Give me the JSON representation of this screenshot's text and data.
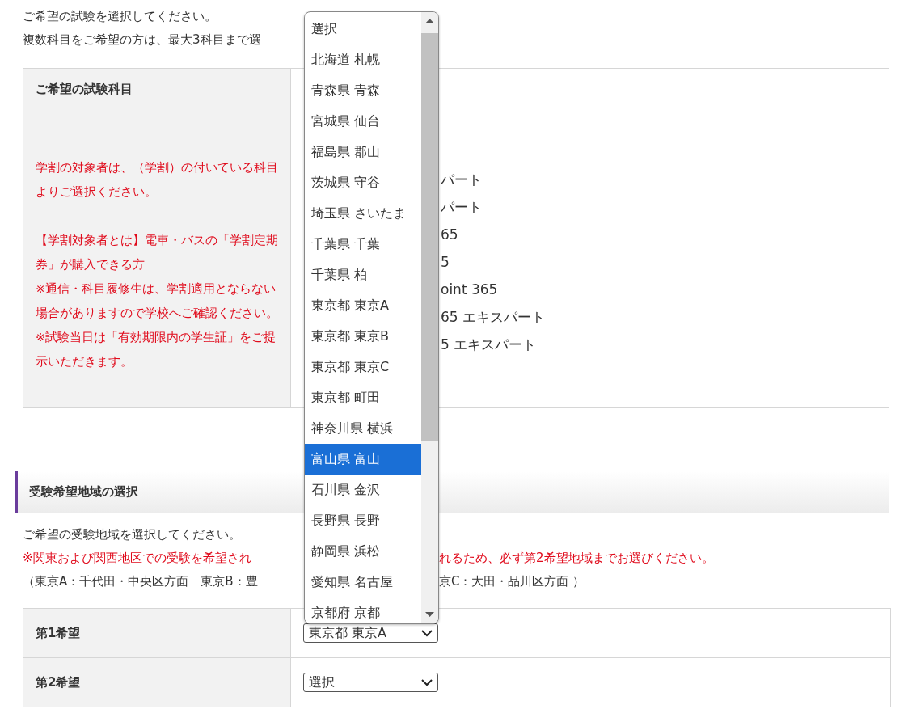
{
  "intro": [
    "ご希望の試験を選択してください。",
    "複数科目をご希望の方は、最大3科目まで選"
  ],
  "subject_table": {
    "header": "ご希望の試験科目",
    "notes": [
      [
        "学割の対象者は、（学割）の付いている科目よりご選択ください。"
      ],
      [
        "【学割対象者とは】電車・バスの「学割定期券」が購入できる方",
        "※通信・科目履修生は、学割適用とならない場合がありますので学校へご確認ください。",
        "※試験当日は「有効期限内の学生証」をご提示いただきます。"
      ]
    ],
    "options": [
      "パート",
      "パート",
      "65",
      "5",
      "oint 365",
      "65 エキスパート",
      "5 エキスパート"
    ]
  },
  "region_section": {
    "title": "受験希望地域の選択",
    "instruction": "ご希望の受験地域を選択してください。",
    "warning": [
      "※関東および関西地区での受験を希望され",
      "れるため、必ず第2希望地域までお選びください。"
    ],
    "legend": [
      "（東京A：千代田・中央区方面　東京B：豊",
      "京C：大田・品川区方面 ）"
    ],
    "rows": [
      {
        "label": "第1希望",
        "value": "東京都 東京A"
      },
      {
        "label": "第2希望",
        "value": "選択"
      }
    ]
  },
  "dropdown_list": {
    "items": [
      {
        "label": "選択",
        "selected": false
      },
      {
        "label": "北海道 札幌",
        "selected": false
      },
      {
        "label": "青森県 青森",
        "selected": false
      },
      {
        "label": "宮城県 仙台",
        "selected": false
      },
      {
        "label": "福島県 郡山",
        "selected": false
      },
      {
        "label": "茨城県 守谷",
        "selected": false
      },
      {
        "label": "埼玉県 さいたま",
        "selected": false
      },
      {
        "label": "千葉県 千葉",
        "selected": false
      },
      {
        "label": "千葉県 柏",
        "selected": false
      },
      {
        "label": "東京都 東京A",
        "selected": false
      },
      {
        "label": "東京都 東京B",
        "selected": false
      },
      {
        "label": "東京都 東京C",
        "selected": false
      },
      {
        "label": "東京都 町田",
        "selected": false
      },
      {
        "label": "神奈川県 横浜",
        "selected": false
      },
      {
        "label": "富山県 富山",
        "selected": true
      },
      {
        "label": "石川県 金沢",
        "selected": false
      },
      {
        "label": "長野県 長野",
        "selected": false
      },
      {
        "label": "静岡県 浜松",
        "selected": false
      },
      {
        "label": "愛知県 名古屋",
        "selected": false
      },
      {
        "label": "京都府 京都",
        "selected": false
      }
    ]
  }
}
